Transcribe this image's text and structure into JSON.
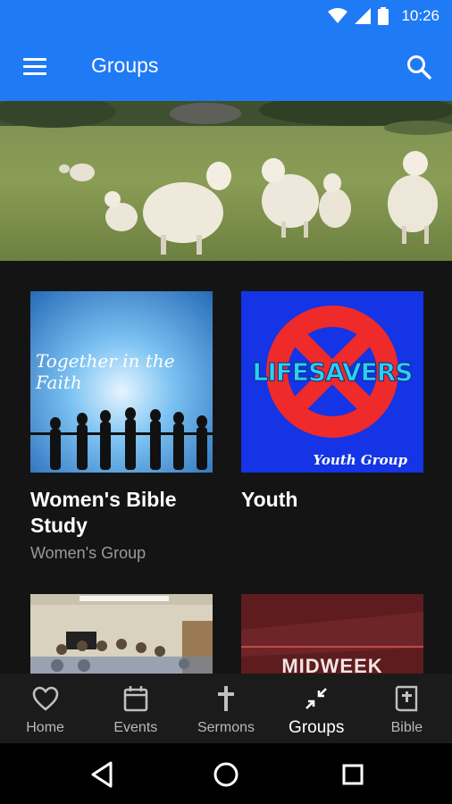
{
  "status_bar": {
    "time": "10:26",
    "icons": [
      "wifi-icon",
      "signal-icon",
      "battery-icon"
    ]
  },
  "app_bar": {
    "title": "Groups",
    "menu_icon": "menu-icon",
    "search_icon": "search-icon"
  },
  "colors": {
    "primary": "#1f7af5",
    "background": "#141414",
    "nav_background": "#1b1b1b",
    "subtitle": "#9a9a9a"
  },
  "groups": [
    {
      "title": "Women's Bible Study",
      "subtitle": "Women's Group",
      "image_text": "Together in the Faith"
    },
    {
      "title": "Youth",
      "subtitle": "",
      "image_text": "LIFESAVERS",
      "image_subtext": "Youth Group"
    },
    {
      "title": "",
      "subtitle": "",
      "image_text": ""
    },
    {
      "title": "",
      "subtitle": "",
      "image_text": "MIDWEEK"
    }
  ],
  "bottom_nav": {
    "items": [
      {
        "label": "Home",
        "icon": "heart-icon"
      },
      {
        "label": "Events",
        "icon": "calendar-icon"
      },
      {
        "label": "Sermons",
        "icon": "cross-icon"
      },
      {
        "label": "Groups",
        "icon": "groups-icon",
        "active": true
      },
      {
        "label": "Bible",
        "icon": "bible-icon"
      }
    ]
  },
  "system_nav": {
    "icons": [
      "back-icon",
      "home-circle-icon",
      "recents-icon"
    ]
  }
}
